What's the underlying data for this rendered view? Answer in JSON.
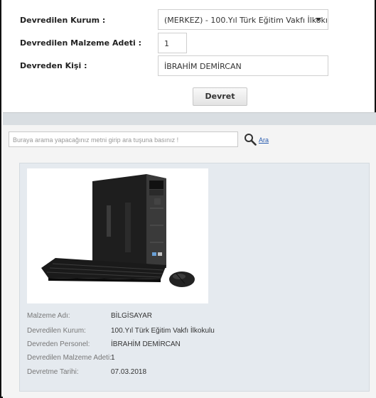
{
  "form": {
    "kurum_label": "Devredilen Kurum :",
    "kurum_value": "(MERKEZ) - 100.Yıl Türk Eğitim Vakfı İlkokı",
    "adet_label": "Devredilen Malzeme Adeti :",
    "adet_value": "1",
    "kisi_label": "Devreden Kişi :",
    "kisi_value": "İBRAHİM DEMİRCAN",
    "submit_label": "Devret"
  },
  "search": {
    "placeholder": "Buraya arama yapacağınız metni girip ara tuşuna basınız !",
    "icon": "search-icon",
    "link_label": "Ara"
  },
  "card": {
    "image": "desktop-computer-image",
    "details": [
      {
        "label": "Malzeme Adı:",
        "value": "BİLGİSAYAR"
      },
      {
        "label": "Devredilen Kurum:",
        "value": "100.Yıl Türk Eğitim Vakfı İlkokulu"
      },
      {
        "label": "Devreden Personel:",
        "value": "İBRAHİM DEMİRCAN"
      },
      {
        "label": "Devredilen Malzeme Adeti:",
        "value": "1"
      },
      {
        "label": "Devretme Tarihi:",
        "value": "07.03.2018"
      }
    ]
  },
  "colors": {
    "link": "#2a5db0",
    "card_background": "#e5eaef",
    "divider": "#d9dee2"
  }
}
